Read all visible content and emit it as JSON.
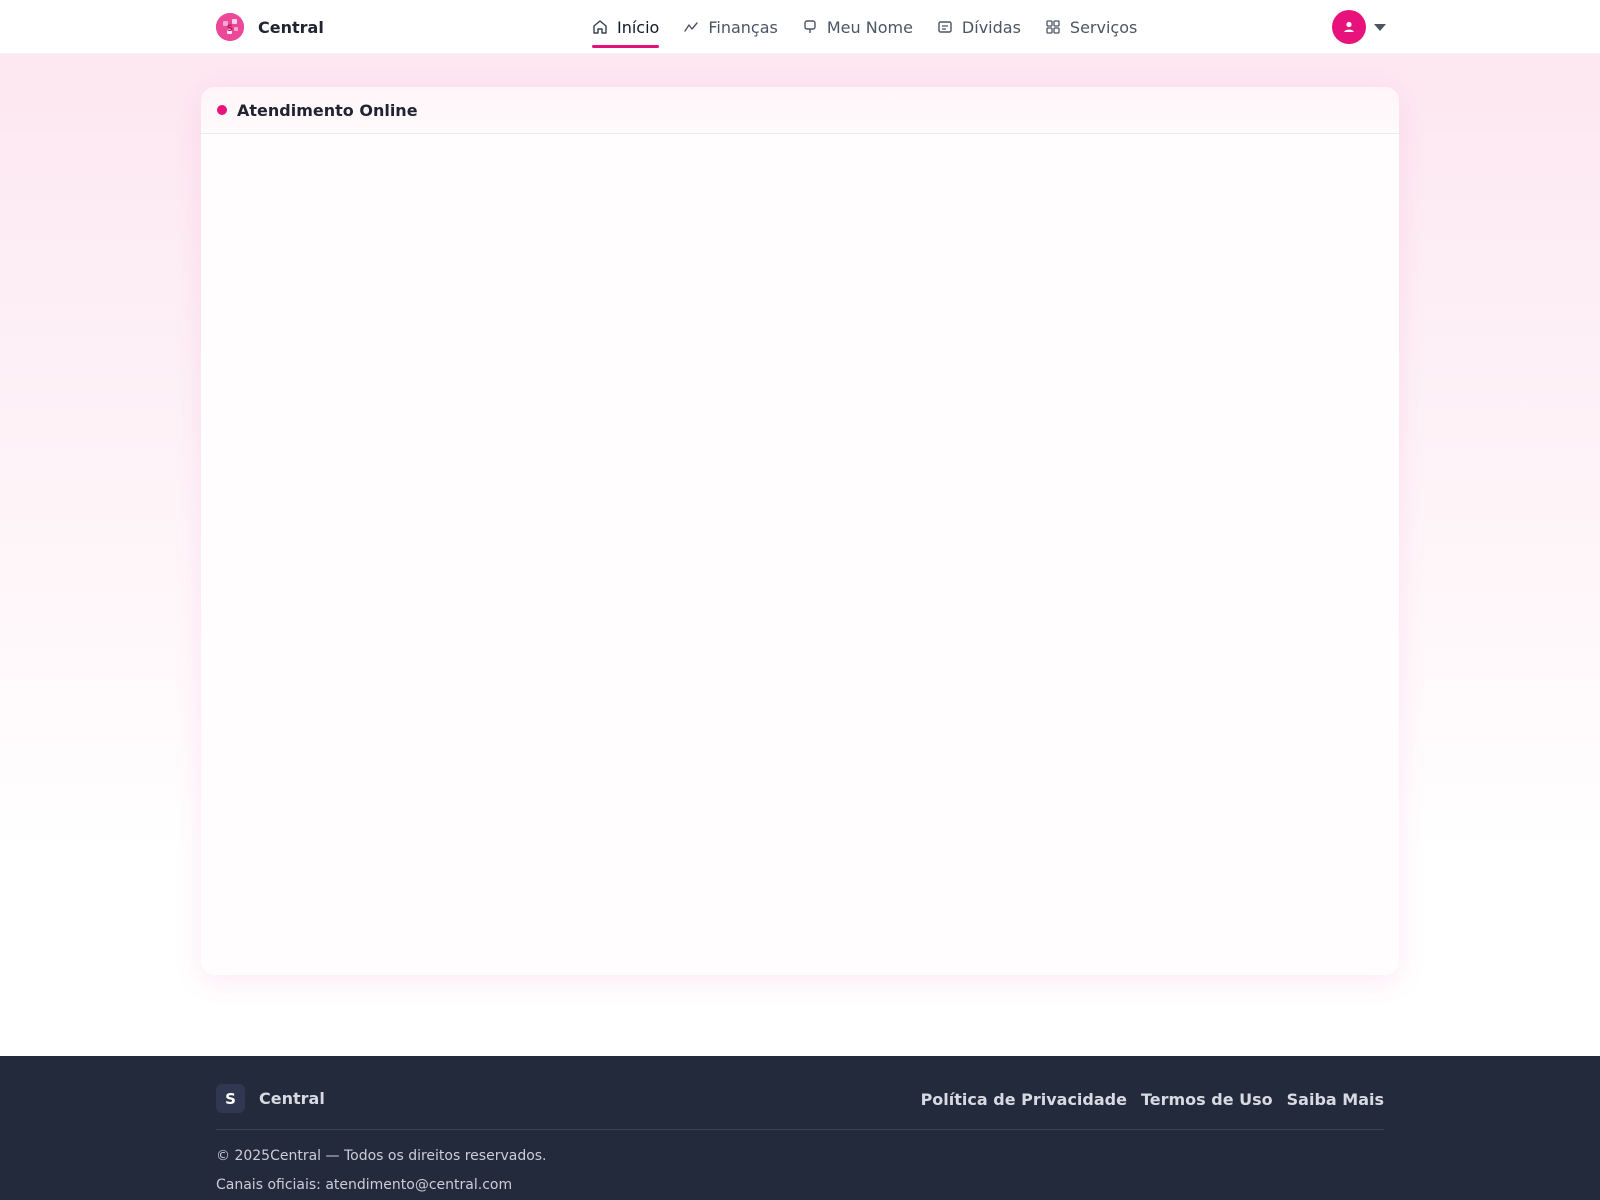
{
  "header": {
    "brand_name": "Central",
    "nav": [
      {
        "label": "Início",
        "icon": "home-icon",
        "active": true
      },
      {
        "label": "Finanças",
        "icon": "trend-icon",
        "active": false
      },
      {
        "label": "Meu Nome",
        "icon": "badge-icon",
        "active": false
      },
      {
        "label": "Dívidas",
        "icon": "document-icon",
        "active": false
      },
      {
        "label": "Serviços",
        "icon": "grid-icon",
        "active": false
      }
    ],
    "user_icon": "user-icon"
  },
  "main": {
    "card_title": "Atendimento Online"
  },
  "footer": {
    "brand_letter": "S",
    "brand_name": "Central",
    "links": [
      "Política de Privacidade",
      "Termos de Uso",
      "Saiba Mais"
    ],
    "copyright": "© 2025Central — Todos os direitos reservados.",
    "contact": "Canais oficiais: atendimento@central.com"
  },
  "colors": {
    "accent": "#e8127c",
    "footer_bg": "#232a3b"
  }
}
